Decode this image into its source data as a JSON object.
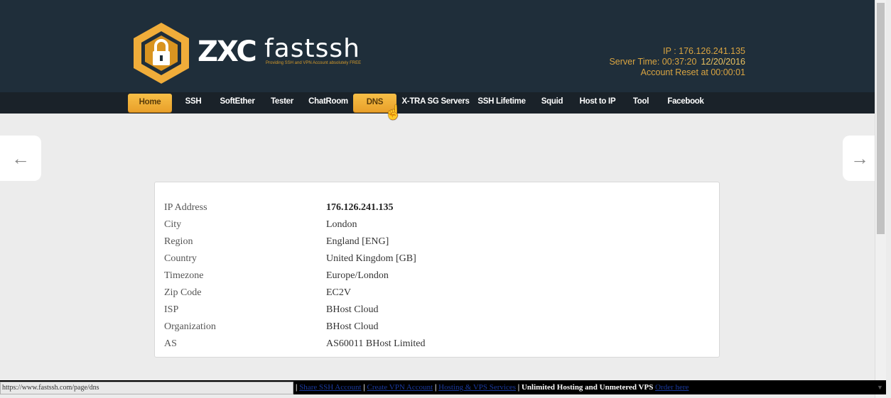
{
  "brand": {
    "name_part1": "ZXC",
    "name_part2": "fastssh",
    "tagline": "Providing SSH and VPN Account absolutely FREE"
  },
  "server_info": {
    "ip_line": "IP : 176.126.241.135",
    "server_time": "Server Time: 00:37:20",
    "date": "12/20/2016",
    "account_reset": "Account Reset at 00:00:01"
  },
  "nav": {
    "items": [
      {
        "label": "Home"
      },
      {
        "label": "SSH"
      },
      {
        "label": "SoftEther"
      },
      {
        "label": "Tester"
      },
      {
        "label": "ChatRoom"
      },
      {
        "label": "DNS"
      },
      {
        "label": "X-TRA SG Servers"
      },
      {
        "label": "SSH Lifetime"
      },
      {
        "label": "Squid"
      },
      {
        "label": "Host to IP"
      },
      {
        "label": "Tool"
      },
      {
        "label": "Facebook"
      }
    ]
  },
  "arrows": {
    "prev": "←",
    "next": "→"
  },
  "ip_details": {
    "rows": [
      {
        "label": "IP Address",
        "value": "176.126.241.135"
      },
      {
        "label": "City",
        "value": "London"
      },
      {
        "label": "Region",
        "value": "England [ENG]"
      },
      {
        "label": "Country",
        "value": "United Kingdom [GB]"
      },
      {
        "label": "Timezone",
        "value": "Europe/London"
      },
      {
        "label": "Zip Code",
        "value": "EC2V"
      },
      {
        "label": "ISP",
        "value": "BHost Cloud"
      },
      {
        "label": "Organization",
        "value": "BHost Cloud"
      },
      {
        "label": "AS",
        "value": "AS60011 BHost Limited"
      }
    ]
  },
  "status_bar": {
    "url": "https://www.fastssh.com/page/dns",
    "sep1": " | ",
    "link1": "Share SSH Account",
    "sep2": " | ",
    "link2": "Create VPN Account",
    "sep3": " | ",
    "link3": "Hosting & VPS Services",
    "sep4": " | ",
    "text": "Unlimited Hosting and Unmetered VPS ",
    "link4": "Order here"
  },
  "colors": {
    "header_bg": "#1f2e3a",
    "nav_bg": "#1a2229",
    "accent": "#f0ad3a",
    "info_text": "#d9a441"
  },
  "icons": {
    "logo": "lock-hexagon-icon",
    "cursor": "hand-pointer-icon"
  }
}
